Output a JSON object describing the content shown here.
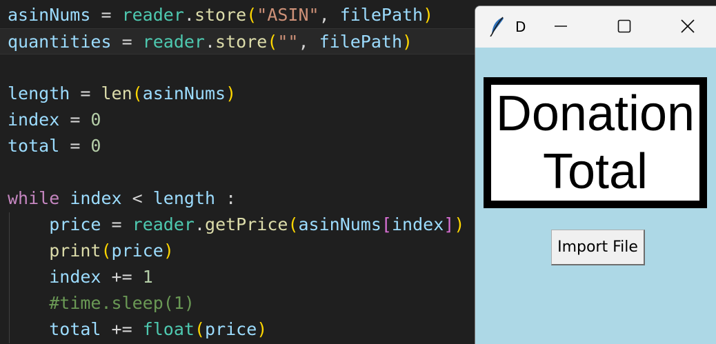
{
  "editor": {
    "lines": [
      {
        "id": "l1",
        "tokens": [
          {
            "t": "asinNums",
            "c": "var"
          },
          {
            "t": " = ",
            "c": "op"
          },
          {
            "t": "reader",
            "c": "cls"
          },
          {
            "t": ".",
            "c": "op"
          },
          {
            "t": "store",
            "c": "fn"
          },
          {
            "t": "(",
            "c": "br1"
          },
          {
            "t": "\"ASIN\"",
            "c": "str"
          },
          {
            "t": ", ",
            "c": "op"
          },
          {
            "t": "filePath",
            "c": "var"
          },
          {
            "t": ")",
            "c": "br1"
          }
        ]
      },
      {
        "id": "l2",
        "tokens": [
          {
            "t": "quantities",
            "c": "var"
          },
          {
            "t": " = ",
            "c": "op"
          },
          {
            "t": "reader",
            "c": "cls"
          },
          {
            "t": ".",
            "c": "op"
          },
          {
            "t": "store",
            "c": "fn"
          },
          {
            "t": "(",
            "c": "br1"
          },
          {
            "t": "\"\"",
            "c": "str"
          },
          {
            "t": ", ",
            "c": "op"
          },
          {
            "t": "filePath",
            "c": "var"
          },
          {
            "t": ")",
            "c": "br1"
          }
        ]
      },
      {
        "id": "l3",
        "tokens": []
      },
      {
        "id": "l4",
        "tokens": [
          {
            "t": "length",
            "c": "var"
          },
          {
            "t": " = ",
            "c": "op"
          },
          {
            "t": "len",
            "c": "fn"
          },
          {
            "t": "(",
            "c": "br1"
          },
          {
            "t": "asinNums",
            "c": "var"
          },
          {
            "t": ")",
            "c": "br1"
          }
        ]
      },
      {
        "id": "l5",
        "tokens": [
          {
            "t": "index",
            "c": "var"
          },
          {
            "t": " = ",
            "c": "op"
          },
          {
            "t": "0",
            "c": "num"
          }
        ]
      },
      {
        "id": "l6",
        "tokens": [
          {
            "t": "total",
            "c": "var"
          },
          {
            "t": " = ",
            "c": "op"
          },
          {
            "t": "0",
            "c": "num"
          }
        ]
      },
      {
        "id": "l7",
        "tokens": []
      },
      {
        "id": "l8",
        "tokens": [
          {
            "t": "while",
            "c": "kw"
          },
          {
            "t": " ",
            "c": "op"
          },
          {
            "t": "index",
            "c": "var"
          },
          {
            "t": " < ",
            "c": "op"
          },
          {
            "t": "length",
            "c": "var"
          },
          {
            "t": " :",
            "c": "op"
          }
        ]
      },
      {
        "id": "l9",
        "tokens": [
          {
            "t": "    ",
            "c": "op"
          },
          {
            "t": "price",
            "c": "var"
          },
          {
            "t": " = ",
            "c": "op"
          },
          {
            "t": "reader",
            "c": "cls"
          },
          {
            "t": ".",
            "c": "op"
          },
          {
            "t": "getPrice",
            "c": "fn"
          },
          {
            "t": "(",
            "c": "br1"
          },
          {
            "t": "asinNums",
            "c": "var"
          },
          {
            "t": "[",
            "c": "br2"
          },
          {
            "t": "index",
            "c": "var"
          },
          {
            "t": "]",
            "c": "br2"
          },
          {
            "t": ")",
            "c": "br1"
          }
        ]
      },
      {
        "id": "l10",
        "tokens": [
          {
            "t": "    ",
            "c": "op"
          },
          {
            "t": "print",
            "c": "fn"
          },
          {
            "t": "(",
            "c": "br1"
          },
          {
            "t": "price",
            "c": "var"
          },
          {
            "t": ")",
            "c": "br1"
          }
        ]
      },
      {
        "id": "l11",
        "tokens": [
          {
            "t": "    ",
            "c": "op"
          },
          {
            "t": "index",
            "c": "var"
          },
          {
            "t": " += ",
            "c": "op"
          },
          {
            "t": "1",
            "c": "num"
          }
        ]
      },
      {
        "id": "l12",
        "tokens": [
          {
            "t": "    ",
            "c": "op"
          },
          {
            "t": "#time.sleep(1)",
            "c": "cmt"
          }
        ]
      },
      {
        "id": "l13",
        "tokens": [
          {
            "t": "    ",
            "c": "op"
          },
          {
            "t": "total",
            "c": "var"
          },
          {
            "t": " += ",
            "c": "op"
          },
          {
            "t": "float",
            "c": "cls"
          },
          {
            "t": "(",
            "c": "br1"
          },
          {
            "t": "price",
            "c": "var"
          },
          {
            "t": ")",
            "c": "br1"
          }
        ]
      }
    ]
  },
  "window": {
    "title": "D",
    "icon": "feather-icon",
    "controls": [
      "minimize-icon",
      "maximize-icon",
      "close-icon"
    ]
  },
  "app": {
    "label_line1": "Donation",
    "label_line2": "Total",
    "import_button": "Import File",
    "background": "#add8e6"
  }
}
